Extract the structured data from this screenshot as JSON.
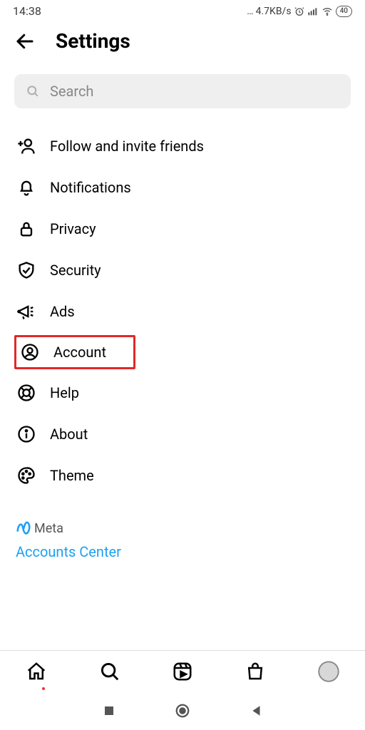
{
  "status": {
    "time": "14:38",
    "net_speed": "4.7KB/s",
    "battery": "40"
  },
  "header": {
    "title": "Settings"
  },
  "search": {
    "placeholder": "Search"
  },
  "items": [
    {
      "id": "follow-invite",
      "label": "Follow and invite friends"
    },
    {
      "id": "notifications",
      "label": "Notifications"
    },
    {
      "id": "privacy",
      "label": "Privacy"
    },
    {
      "id": "security",
      "label": "Security"
    },
    {
      "id": "ads",
      "label": "Ads"
    },
    {
      "id": "account",
      "label": "Account"
    },
    {
      "id": "help",
      "label": "Help"
    },
    {
      "id": "about",
      "label": "About"
    },
    {
      "id": "theme",
      "label": "Theme"
    }
  ],
  "meta": {
    "brand": "Meta",
    "accounts_center": "Accounts Center"
  },
  "highlighted_item": "account",
  "colors": {
    "link": "#1ea1f1",
    "highlight_border": "#e22828",
    "search_bg": "#efefef"
  }
}
